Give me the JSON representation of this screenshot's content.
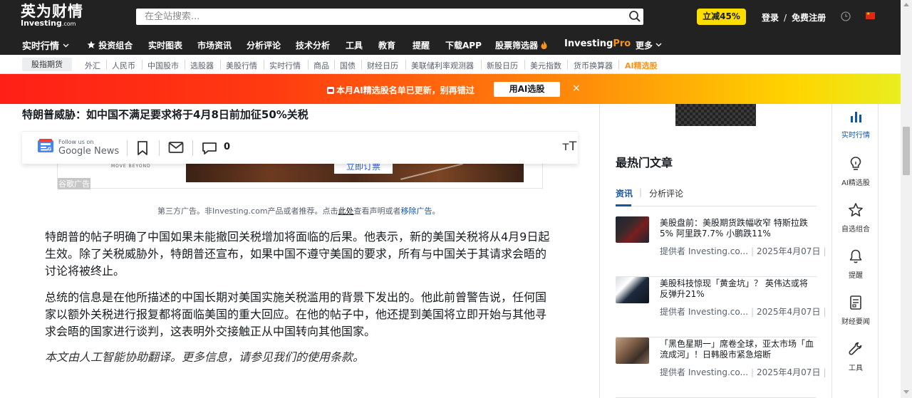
{
  "header": {
    "logo_cn": "英为财情",
    "logo_en": "Investing",
    "logo_en_suffix": ".com",
    "search_placeholder": "在全站搜索...",
    "promo_label": "立减45%",
    "login_label": "登录",
    "auth_separator": "/",
    "register_label": "免费注册"
  },
  "main_nav": {
    "items": [
      "实时行情",
      "投资组合",
      "实时图表",
      "市场资讯",
      "分析评论",
      "技术分析",
      "工具",
      "教育",
      "提醒",
      "下载APP",
      "股票筛选器",
      "Investing",
      "Pro",
      "更多"
    ]
  },
  "sub_nav": {
    "active": "股指期货",
    "items": [
      "外汇",
      "人民币",
      "中国股市",
      "选股器",
      "美股行情",
      "实时行情",
      "商品",
      "国债",
      "财经日历",
      "美联储利率观测器",
      "新股日历",
      "美元指数",
      "货币换算器",
      "AI精选股"
    ]
  },
  "banner": {
    "message": "本月AI精选股名单已更新，别再错过",
    "cta": "用AI选股",
    "close": "×"
  },
  "article": {
    "headline": "特朗普威胁：如中国不满足要求将于4月8日前加征50%关税",
    "follow_text": "Follow us on",
    "google_news": "Google News",
    "comment_count": "0",
    "font_size_glyph": "тT",
    "ad": {
      "move_beyond": "MOVE BEYOND",
      "button": "立即订票",
      "google_ad_label": "谷歌广告"
    },
    "disclaimer": {
      "part1": "第三方广告。非Investing.com产品或者推荐。点击",
      "link_here": "此处",
      "part2": "查看声明或者",
      "link_remove": "移除广告",
      "part3": "。"
    },
    "paragraphs": [
      "特朗普的帖子明确了中国如果未能撤回关税增加将面临的后果。他表示，新的美国关税将从4月9日起生效。除了关税威胁外，特朗普还宣布，如果中国不遵守美国的要求，所有与中国关于其请求会晤的讨论将被终止。",
      "总统的信息是在他所描述的中国长期对美国实施关税滥用的背景下发出的。他此前曾警告说，任何国家以额外关税进行报复都将面临美国的重大回应。在他的帖子中，他还提到美国将立即开始与其他寻求会晤的国家进行谈判，这表明外交接触正从中国转向其他国家。",
      "本文由人工智能协助翻译。更多信息，请参见我们的使用条款。"
    ]
  },
  "sidebar": {
    "title": "最热门文章",
    "tabs": [
      "资讯",
      "分析评论"
    ],
    "tab_separator": "|",
    "news": [
      {
        "title": "美股盘前：美股期货跌幅收窄 特斯拉跌5% 阿里跌7.7% 小鹏跌11%",
        "source": "提供者 Investing.co...",
        "date": "2025年4月07日"
      },
      {
        "title": "美股科技惊现「黄金坑」？ 英伟达或将反弹升21%",
        "source": "提供者 Investing.co...",
        "date": "2025年4月07日"
      },
      {
        "title": "「黑色星期一」席卷全球，亚太市场「血流成河」！日韩股市紧急熔断",
        "source": "提供者 Investing.co...",
        "date": "2025年4月07日"
      }
    ]
  },
  "rail": {
    "items": [
      "实时行情",
      "AI精选股",
      "自选组合",
      "提醒",
      "财经要闻",
      "工具"
    ]
  },
  "colors": {
    "header_bg": "#222222",
    "promo_yellow": "#fbde00",
    "accent_blue": "#1256a0",
    "pro_orange": "#f7941d",
    "banner_red": "#ff1f17",
    "banner_yellow": "#ffd400"
  },
  "icons": [
    "search-icon",
    "clock-icon",
    "china-flag-icon",
    "chevron-down-icon",
    "star-icon",
    "fire-icon",
    "google-news-icon",
    "bookmark-icon",
    "mail-icon",
    "comment-icon",
    "bar-chart-icon",
    "lightbulb-icon",
    "bell-icon",
    "document-icon",
    "wrench-icon"
  ]
}
